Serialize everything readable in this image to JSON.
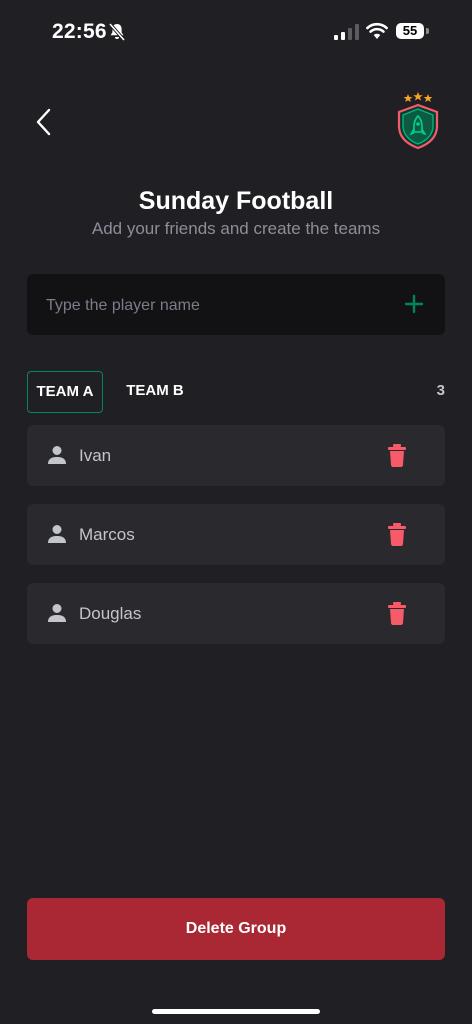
{
  "status_bar": {
    "time": "22:56",
    "battery": "55"
  },
  "header": {
    "title": "Sunday Football",
    "subtitle": "Add your friends and create the teams"
  },
  "input": {
    "placeholder": "Type the player name",
    "value": ""
  },
  "tabs": [
    {
      "label": "TEAM A",
      "selected": true
    },
    {
      "label": "TEAM B",
      "selected": false
    }
  ],
  "player_count": "3",
  "players": [
    {
      "name": "Ivan"
    },
    {
      "name": "Marcos"
    },
    {
      "name": "Douglas"
    }
  ],
  "delete_button": {
    "label": "Delete Group"
  },
  "colors": {
    "background": "#202024",
    "input_background": "#121214",
    "card_background": "#29292e",
    "accent_green": "#00875f",
    "danger_red": "#f75a68",
    "delete_button": "#aa2834"
  },
  "icons": {
    "back": "chevron-left-icon",
    "add": "plus-icon",
    "player": "user-icon",
    "remove": "trash-icon",
    "logo": "shield-stars-icon"
  }
}
